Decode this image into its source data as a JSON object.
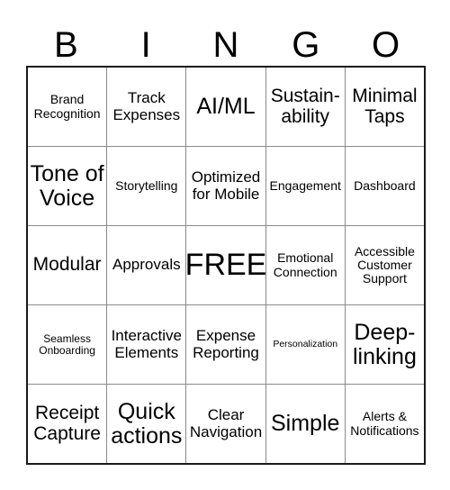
{
  "card": {
    "title": "BINGO",
    "header_letters": [
      "B",
      "I",
      "N",
      "G",
      "O"
    ],
    "free_space_label": "FREE",
    "colors": {
      "background": "#ffffff",
      "text": "#000000",
      "outer_border": "#1a1a1a",
      "inner_border": "#8a8a8a"
    },
    "rows": [
      {
        "cells": [
          {
            "label": "Brand Recognition",
            "size": "fs-sm"
          },
          {
            "label": "Track Expenses",
            "size": "fs-md"
          },
          {
            "label": "AI/ML",
            "size": "fs-xl"
          },
          {
            "label": "Sustain- ability",
            "size": "fs-lg"
          },
          {
            "label": "Minimal Taps",
            "size": "fs-lg"
          }
        ]
      },
      {
        "cells": [
          {
            "label": "Tone of Voice",
            "size": "fs-xl"
          },
          {
            "label": "Storytelling",
            "size": "fs-sm"
          },
          {
            "label": "Optimized for Mobile",
            "size": "fs-md"
          },
          {
            "label": "Engagement",
            "size": "fs-sm"
          },
          {
            "label": "Dashboard",
            "size": "fs-sm"
          }
        ]
      },
      {
        "cells": [
          {
            "label": "Modular",
            "size": "fs-lg"
          },
          {
            "label": "Approvals",
            "size": "fs-md"
          },
          {
            "label": "FREE",
            "size": "fs-xxl"
          },
          {
            "label": "Emotional Connection",
            "size": "fs-sm"
          },
          {
            "label": "Accessible Customer Support",
            "size": "fs-sm"
          }
        ]
      },
      {
        "cells": [
          {
            "label": "Seamless Onboarding",
            "size": "fs-xs"
          },
          {
            "label": "Interactive Elements",
            "size": "fs-md"
          },
          {
            "label": "Expense Reporting",
            "size": "fs-md"
          },
          {
            "label": "Personalization",
            "size": "fs-xxs"
          },
          {
            "label": "Deep- linking",
            "size": "fs-xl"
          }
        ]
      },
      {
        "cells": [
          {
            "label": "Receipt Capture",
            "size": "fs-lg"
          },
          {
            "label": "Quick actions",
            "size": "fs-xl"
          },
          {
            "label": "Clear Navigation",
            "size": "fs-md"
          },
          {
            "label": "Simple",
            "size": "fs-xl"
          },
          {
            "label": "Alerts & Notifications",
            "size": "fs-sm"
          }
        ]
      }
    ]
  }
}
